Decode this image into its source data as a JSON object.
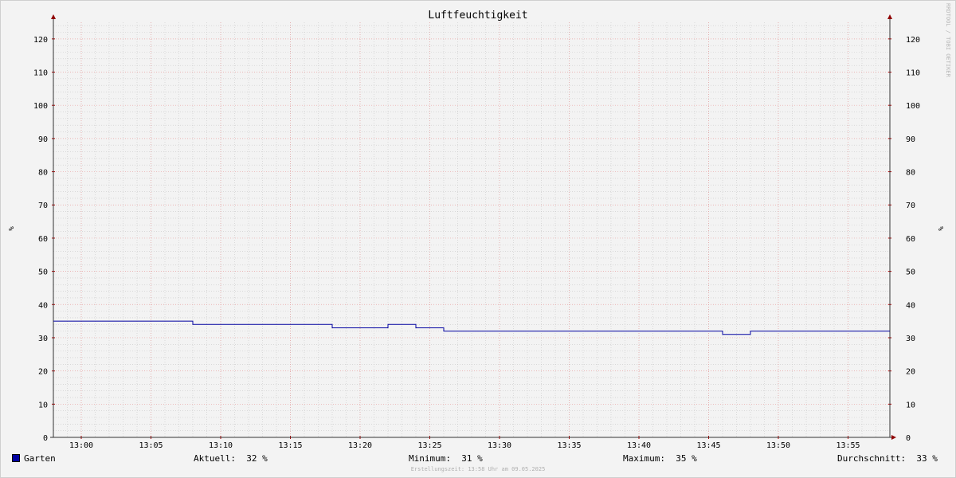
{
  "chart_data": {
    "type": "line",
    "title": "Luftfeuchtigkeit",
    "ylabel": "%",
    "ylabel_right": "%",
    "ylim": [
      0,
      125
    ],
    "yticks": [
      0,
      10,
      20,
      30,
      40,
      50,
      60,
      70,
      80,
      90,
      100,
      110,
      120
    ],
    "x_range": [
      "12:58",
      "13:58"
    ],
    "xticks": [
      "13:00",
      "13:05",
      "13:10",
      "13:15",
      "13:20",
      "13:25",
      "13:30",
      "13:35",
      "13:40",
      "13:45",
      "13:50",
      "13:55"
    ],
    "grid": true,
    "series": [
      {
        "name": "Garten",
        "color": "#0000a0",
        "step": true,
        "points": [
          {
            "x": "12:58",
            "y": 35
          },
          {
            "x": "13:08",
            "y": 34
          },
          {
            "x": "13:18",
            "y": 33
          },
          {
            "x": "13:22",
            "y": 34
          },
          {
            "x": "13:24",
            "y": 33
          },
          {
            "x": "13:26",
            "y": 32
          },
          {
            "x": "13:46",
            "y": 31
          },
          {
            "x": "13:48",
            "y": 32
          },
          {
            "x": "13:58",
            "y": 32
          }
        ]
      }
    ]
  },
  "legend": {
    "series_name": "Garten",
    "current": "Aktuell:  32 %",
    "minimum": "Minimum:  31 %",
    "maximum": "Maximum:  35 %",
    "average": "Durchschnitt:  33 %"
  },
  "footer": "Erstellungszeit: 13:58 Uhr am 09.05.2025",
  "vendor": "RRDTOOL / TOBI OETIKER"
}
